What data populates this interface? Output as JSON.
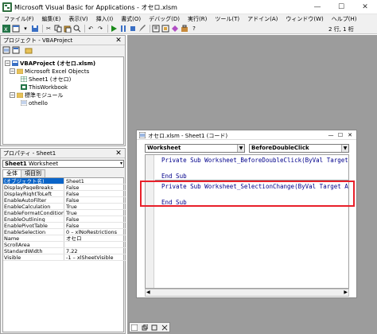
{
  "window": {
    "title": "Microsoft Visual Basic for Applications - オセロ.xlsm",
    "minimize": "—",
    "maximize": "☐",
    "close": "✕"
  },
  "menu": [
    "ファイル(F)",
    "編集(E)",
    "表示(V)",
    "挿入(I)",
    "書式(O)",
    "デバッグ(D)",
    "実行(R)",
    "ツール(T)",
    "アドイン(A)",
    "ウィンドウ(W)",
    "ヘルプ(H)"
  ],
  "toolbar": {
    "position_text": "2 行, 1 桁"
  },
  "project_panel": {
    "title": "プロジェクト - VBAProject",
    "close": "✕",
    "tree": {
      "root": "VBAProject (オセロ.xlsm)",
      "excel_objects": "Microsoft Excel Objects",
      "sheet1": "Sheet1 (オセロ)",
      "thisworkbook": "ThisWorkbook",
      "modules": "標準モジュール",
      "othello": "othello",
      "expander_root": "−",
      "expander_objects": "−",
      "expander_modules": "−"
    }
  },
  "properties_panel": {
    "title": "プロパティ - Sheet1",
    "close": "✕",
    "object_name": "Sheet1",
    "object_type": "Worksheet",
    "tabs": [
      "全体",
      "項目別"
    ],
    "rows": [
      {
        "key": "(オブジェクト名)",
        "value": "Sheet1"
      },
      {
        "key": "DisplayPageBreaks",
        "value": "False"
      },
      {
        "key": "DisplayRightToLeft",
        "value": "False"
      },
      {
        "key": "EnableAutoFilter",
        "value": "False"
      },
      {
        "key": "EnableCalculation",
        "value": "True"
      },
      {
        "key": "EnableFormatConditionsCa",
        "value": "True"
      },
      {
        "key": "EnableOutlining",
        "value": "False"
      },
      {
        "key": "EnablePivotTable",
        "value": "False"
      },
      {
        "key": "EnableSelection",
        "value": "0 – xlNoRestrictions"
      },
      {
        "key": "Name",
        "value": "オセロ"
      },
      {
        "key": "ScrollArea",
        "value": ""
      },
      {
        "key": "StandardWidth",
        "value": "7.22"
      },
      {
        "key": "Visible",
        "value": "-1 – xlSheetVisible"
      }
    ]
  },
  "code_window": {
    "title": "オセロ.xlsm - Sheet1 (コード)",
    "object_combo": "Worksheet",
    "proc_combo": "BeforeDoubleClick",
    "lines": [
      "Private Sub Worksheet_BeforeDoubleClick(ByVal Target As Range",
      "",
      "End Sub",
      "Private Sub Worksheet_SelectionChange(ByVal Target As Range)",
      "",
      "End Sub"
    ],
    "minimize": "—",
    "maximize": "☐",
    "close": "✕"
  },
  "colors": {
    "highlight": "#e8202a",
    "mdi_background": "#9c9c9c",
    "code_text": "#00008b",
    "selected_row": "#0a64c8"
  }
}
